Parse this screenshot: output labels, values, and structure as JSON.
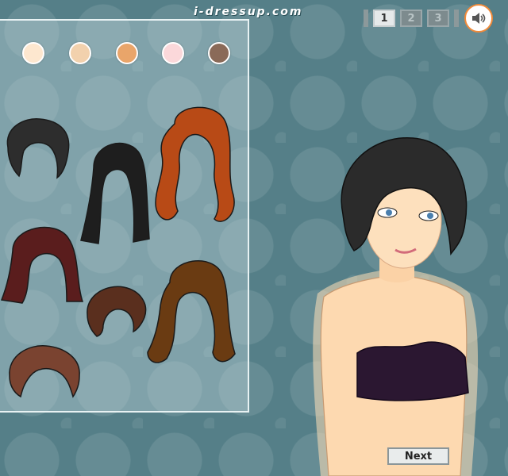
{
  "brand": "i-dressup.com",
  "pages": [
    "1",
    "2",
    "3"
  ],
  "active_page": "1",
  "sound_icon": "speaker-icon",
  "hair_colors": [
    "#fde7cf",
    "#f2d1ad",
    "#e9a56a",
    "#fbd8da",
    "#8a6a58"
  ],
  "hairstyles": [
    {
      "name": "short-black-bob",
      "color": "#2d2d2d"
    },
    {
      "name": "long-straight-black",
      "color": "#1e1e1e"
    },
    {
      "name": "long-curly-auburn",
      "color": "#b84a16"
    },
    {
      "name": "shoulder-burgundy",
      "color": "#5a1d1d"
    },
    {
      "name": "messy-short-brown",
      "color": "#5a2f1e"
    },
    {
      "name": "long-wavy-brown",
      "color": "#6a3b12"
    },
    {
      "name": "short-bowl-brown",
      "color": "#7a4330"
    }
  ],
  "next_label": "Next"
}
